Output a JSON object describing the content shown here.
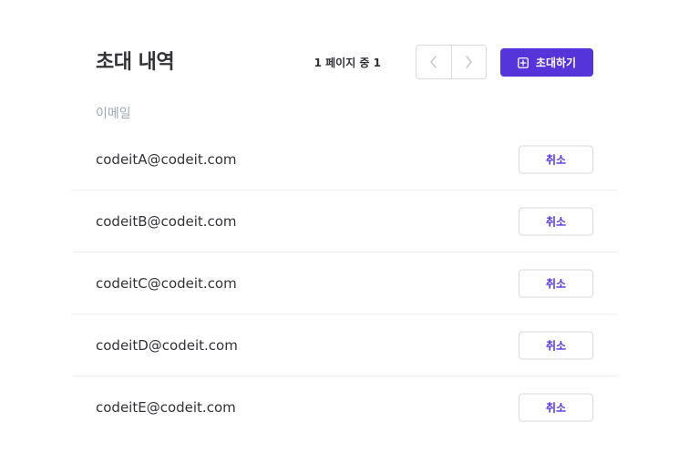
{
  "invitations": {
    "title": "초대 내역",
    "pagination": {
      "text": "1 페이지 중 1",
      "prev_icon": "chevron-left-icon",
      "next_icon": "chevron-right-icon"
    },
    "invite_button": {
      "label": "초대하기",
      "icon": "add-box-icon"
    },
    "column_label": "이메일",
    "rows": [
      {
        "email": "codeitA@codeit.com",
        "action": "취소"
      },
      {
        "email": "codeitB@codeit.com",
        "action": "취소"
      },
      {
        "email": "codeitC@codeit.com",
        "action": "취소"
      },
      {
        "email": "codeitD@codeit.com",
        "action": "취소"
      },
      {
        "email": "codeitE@codeit.com",
        "action": "취소"
      }
    ]
  },
  "colors": {
    "accent": "#5534da",
    "text_primary": "#333236",
    "text_muted": "#9fa6b2",
    "border": "#d9d9d9",
    "divider": "#eeeeee"
  }
}
